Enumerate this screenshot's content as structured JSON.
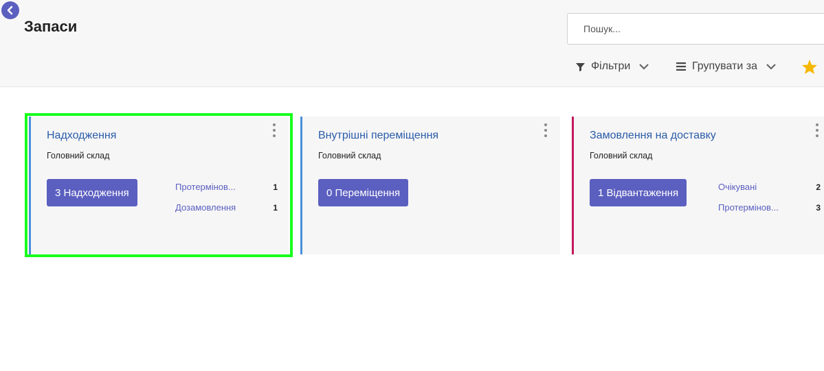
{
  "page_title": "Запаси",
  "search": {
    "placeholder": "Пошук..."
  },
  "toolbar": {
    "filters_label": "Фільтри",
    "group_by_label": "Групувати за",
    "favorites_icon": "star-icon"
  },
  "colors": {
    "accent": "#5b5fc0",
    "card1_bar": "#4a90d9",
    "card2_bar": "#4a90d9",
    "card3_bar": "#c2185b",
    "highlight": "#17ff1d",
    "favorite": "#f5b800"
  },
  "cards": [
    {
      "title": "Надходження",
      "subtitle": "Головний склад",
      "button": "3 Надходження",
      "stats": [
        {
          "label": "Протермінов...",
          "value": "1"
        },
        {
          "label": "Дозамовлення",
          "value": "1"
        }
      ]
    },
    {
      "title": "Внутрішні переміщення",
      "subtitle": "Головний склад",
      "button": "0 Переміщення",
      "stats": []
    },
    {
      "title": "Замовлення на доставку",
      "subtitle": "Головний склад",
      "button": "1 Відвантаження",
      "stats": [
        {
          "label": "Очікувані",
          "value": "2"
        },
        {
          "label": "Протермінов...",
          "value": "3"
        }
      ]
    }
  ]
}
